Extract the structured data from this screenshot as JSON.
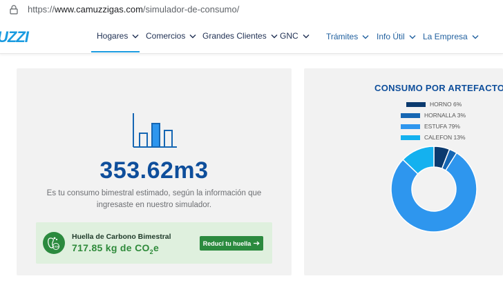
{
  "browser": {
    "url_scheme": "https://",
    "url_host": "www.camuzzigas.com",
    "url_path": "/simulador-de-consumo/"
  },
  "header": {
    "logo_text": "UZZI",
    "nav_main": [
      "Hogares",
      "Comercios",
      "Grandes Clientes",
      "GNC"
    ],
    "nav_secondary": [
      "Trámites",
      "Info Útil",
      "La Empresa"
    ],
    "active_item": "Hogares"
  },
  "result": {
    "value": "353.62m3",
    "description": "Es tu consumo bimestral estimado, según la información que ingresaste en nuestro simulador."
  },
  "carbon": {
    "title": "Huella de Carbono Bimestral",
    "value_main": "717.85 kg de CO",
    "value_sub": "2",
    "value_tail": "e",
    "button_label": "Reducí tu huella",
    "icon": "co2-footprint-icon"
  },
  "chart_data": {
    "type": "pie",
    "title": "CONSUMO POR ARTEFACTO",
    "donut": true,
    "categories": [
      "HORNO",
      "HORNALLA",
      "ESTUFA",
      "CALEFON"
    ],
    "values": [
      6,
      3,
      79,
      13
    ],
    "legend_labels": [
      "HORNO 6%",
      "HORNALLA 3%",
      "ESTUFA 79%",
      "CALEFON 13%"
    ],
    "colors": [
      "#0b3a6e",
      "#1566b3",
      "#2e96ee",
      "#14b1ef"
    ],
    "legend_position": "top"
  },
  "colors": {
    "brand_blue": "#0e4e9b",
    "accent_cyan": "#1a9be0",
    "green_button": "#2b8a3e"
  }
}
